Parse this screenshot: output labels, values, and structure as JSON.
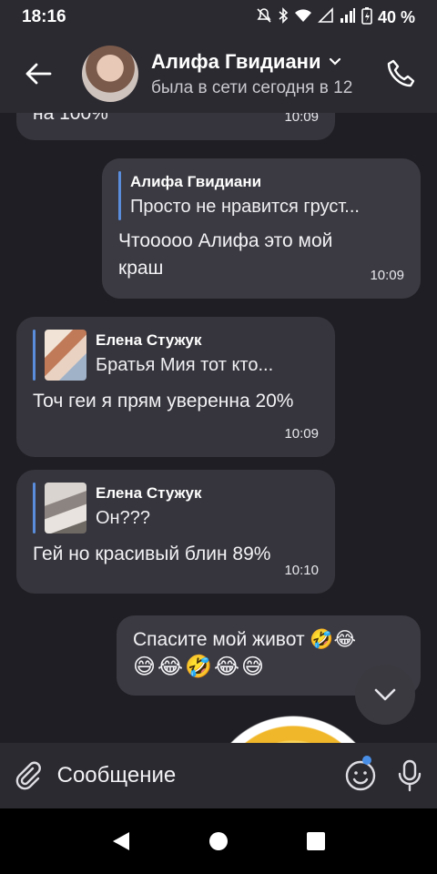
{
  "status_bar": {
    "time": "18:16",
    "battery": "40 %",
    "icons": [
      "mute-icon",
      "bluetooth-icon",
      "wifi-icon",
      "signal-icon",
      "battery-icon"
    ]
  },
  "header": {
    "name": "Алифа Гвидиани",
    "status": "была в сети сегодня в 12",
    "icons": [
      "back-arrow-icon",
      "chevron-down-icon",
      "phone-icon"
    ]
  },
  "messages": [
    {
      "direction": "in",
      "text": "на 100%",
      "time": "10:09"
    },
    {
      "direction": "out",
      "quote_name": "Алифа Гвидиани",
      "quote_text": "Просто не нравится груст...",
      "text": "Чтооооо Алифа это мой краш",
      "time": "10:09"
    },
    {
      "direction": "in",
      "quote_name": "Елена Стужук",
      "quote_text": "Братья Мия тот кто...",
      "text": "Точ геи я прям уверенна 20%",
      "time": "10:09"
    },
    {
      "direction": "in",
      "quote_name": "Елена Стужук",
      "quote_text": "Он???",
      "text": "Гей но красивый блин 89%",
      "time": "10:10"
    },
    {
      "direction": "out",
      "text": "Спасите мой живот 🤣😂",
      "emojis": "😅😂🤣😂😅"
    }
  ],
  "composer": {
    "placeholder": "Сообщение",
    "icons": [
      "attach-icon",
      "emoji-icon",
      "mic-icon"
    ]
  },
  "nav_bar": {
    "icons": [
      "back-nav-icon",
      "home-nav-icon",
      "recents-nav-icon"
    ]
  },
  "colors": {
    "background": "#1f1e24",
    "bar": "#2b2a31",
    "bubble": "#36353d",
    "quote_accent": "#5a8edc",
    "unread_dot": "#4a8fe7"
  }
}
